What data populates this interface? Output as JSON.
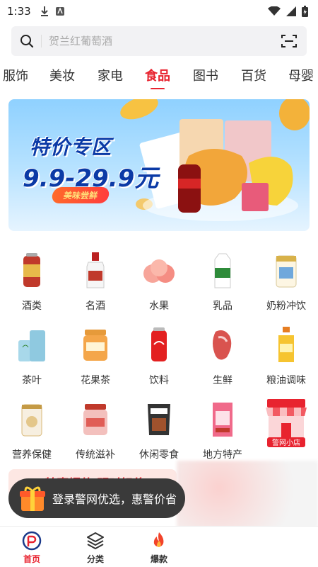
{
  "status_bar": {
    "time": "1:33"
  },
  "search": {
    "placeholder": "贺兰红葡萄酒"
  },
  "tabs": [
    {
      "label": "服饰"
    },
    {
      "label": "美妆"
    },
    {
      "label": "家电"
    },
    {
      "label": "食品",
      "active": true
    },
    {
      "label": "图书"
    },
    {
      "label": "百货"
    },
    {
      "label": "母婴"
    }
  ],
  "banner": {
    "title": "特价专区",
    "price": "9.9-29.9元",
    "tag": "美味尝鲜"
  },
  "categories": [
    {
      "label": "酒类",
      "icon": "beer-can-icon"
    },
    {
      "label": "名酒",
      "icon": "liquor-bottle-icon"
    },
    {
      "label": "水果",
      "icon": "peach-icon"
    },
    {
      "label": "乳品",
      "icon": "milk-carton-icon"
    },
    {
      "label": "奶粉冲饮",
      "icon": "milk-powder-can-icon"
    },
    {
      "label": "茶叶",
      "icon": "tea-can-icon"
    },
    {
      "label": "花果茶",
      "icon": "flower-tea-jar-icon"
    },
    {
      "label": "饮料",
      "icon": "soda-can-icon"
    },
    {
      "label": "生鲜",
      "icon": "meat-icon"
    },
    {
      "label": "粮油调味",
      "icon": "oil-bottle-icon"
    },
    {
      "label": "营养保健",
      "icon": "supplement-can-icon"
    },
    {
      "label": "传统滋补",
      "icon": "tonic-jar-icon"
    },
    {
      "label": "休闲零食",
      "icon": "snack-bag-icon"
    },
    {
      "label": "地方特产",
      "icon": "specialty-bag-icon"
    },
    {
      "label": "警网小店",
      "icon": "shop-icon"
    }
  ],
  "promo": {
    "text": "特惠爆款 明时好价"
  },
  "toast": {
    "text": "登录警网优选，惠警价省"
  },
  "bottom_nav": [
    {
      "label": "首页",
      "icon": "home-logo-icon",
      "active": true
    },
    {
      "label": "分类",
      "icon": "layers-icon"
    },
    {
      "label": "爆款",
      "icon": "flame-icon"
    }
  ],
  "colors": {
    "accent": "#e8232f",
    "banner_blue": "#0b3aa6"
  }
}
